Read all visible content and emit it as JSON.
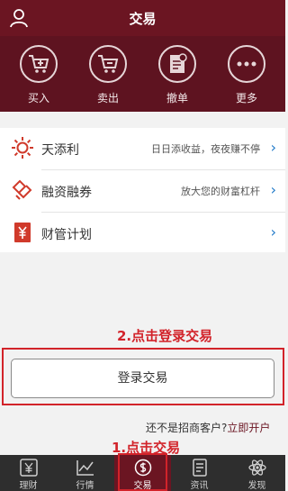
{
  "header": {
    "title": "交易"
  },
  "actions": [
    {
      "label": "买入",
      "icon": "cart-plus-icon"
    },
    {
      "label": "卖出",
      "icon": "cart-minus-icon"
    },
    {
      "label": "撤单",
      "icon": "cancel-order-icon"
    },
    {
      "label": "更多",
      "icon": "more-icon"
    }
  ],
  "list": [
    {
      "name": "天添利",
      "desc": "日日添收益，夜夜赚不停",
      "icon": "sun-icon"
    },
    {
      "name": "融资融券",
      "desc": "放大您的财富杠杆",
      "icon": "hands-icon"
    },
    {
      "name": "财管计划",
      "desc": "",
      "icon": "yen-book-icon"
    }
  ],
  "annotations": {
    "step2": "2.点击登录交易",
    "step1": "1.点击交易"
  },
  "login": {
    "button_label": "登录交易",
    "open_prefix": "还不是招商客户?",
    "open_link": "立即开户"
  },
  "tabs": [
    {
      "label": "理财",
      "icon": "yen-tab-icon"
    },
    {
      "label": "行情",
      "icon": "chart-tab-icon"
    },
    {
      "label": "交易",
      "icon": "trade-tab-icon"
    },
    {
      "label": "资讯",
      "icon": "news-tab-icon"
    },
    {
      "label": "发现",
      "icon": "atom-tab-icon"
    }
  ],
  "colors": {
    "header": "#6b1522",
    "action_bar": "#5e1320",
    "annotation": "#d2232a",
    "tabbar": "#2e2e2e",
    "chevron": "#1e78c8"
  }
}
